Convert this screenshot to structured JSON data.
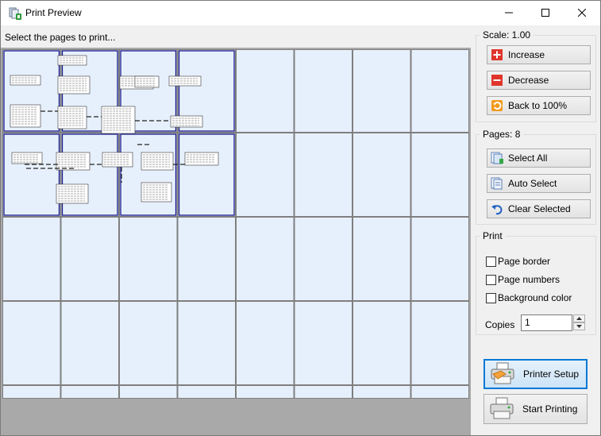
{
  "window": {
    "title": "Print Preview"
  },
  "preview": {
    "instruction": "Select the pages to print..."
  },
  "scale": {
    "label": "Scale: 1.00",
    "increase": "Increase",
    "decrease": "Decrease",
    "reset": "Back to 100%"
  },
  "pages": {
    "label": "Pages: 8",
    "select_all": "Select All",
    "auto_select": "Auto Select",
    "clear_selected": "Clear Selected"
  },
  "print": {
    "label": "Print",
    "page_border": "Page border",
    "page_numbers": "Page numbers",
    "background_color": "Background color",
    "copies_label": "Copies",
    "copies_value": "1"
  },
  "actions": {
    "printer_setup": "Printer Setup",
    "start_printing": "Start Printing"
  },
  "colors": {
    "page_bg": "#e6f0fc",
    "selected_border": "#1a1a8c",
    "grid_line": "#7f7f7f",
    "focus_border": "#0078d7"
  }
}
